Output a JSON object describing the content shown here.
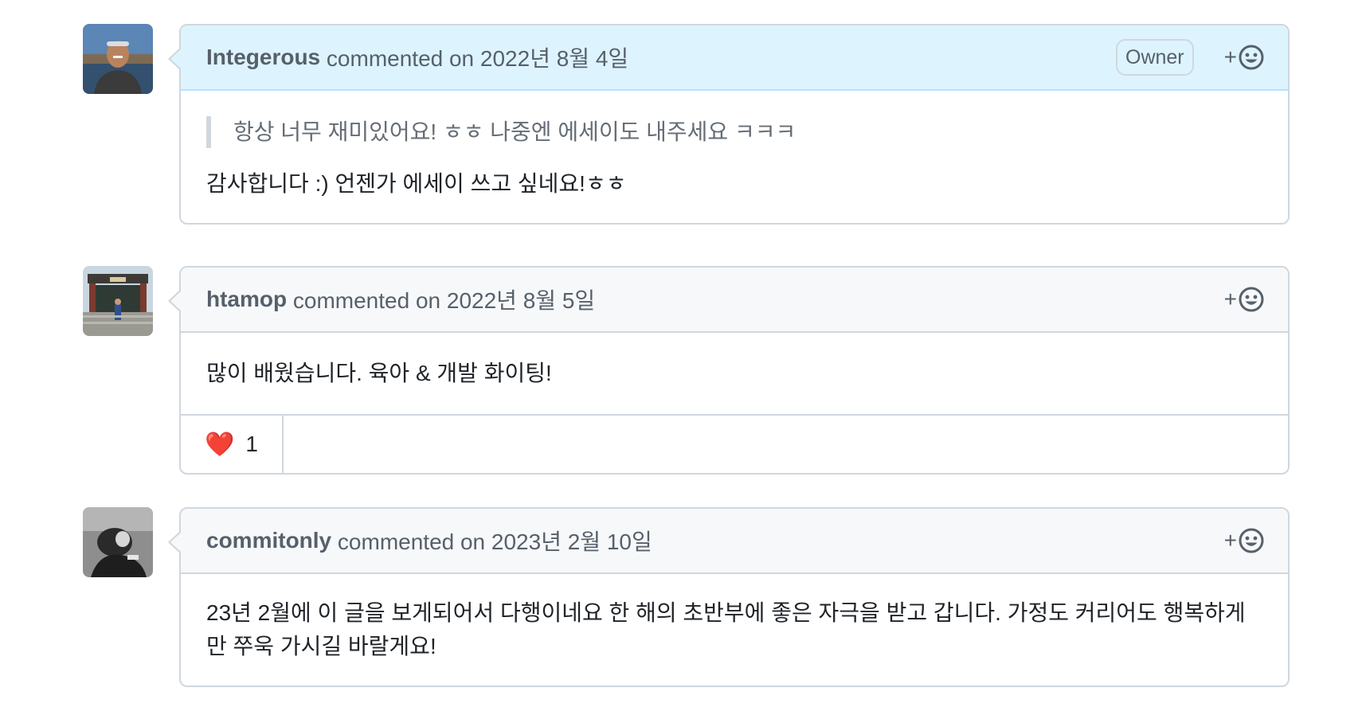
{
  "comments": [
    {
      "author": "Integerous",
      "meta": " commented on 2022년 8월 4일",
      "badge": "Owner",
      "quote": "항상 너무 재미있어요! ㅎㅎ 나중엔 에세이도 내주세요 ㅋㅋㅋ",
      "body": "감사합니다 :) 언젠가 에세이 쓰고 싶네요!ㅎㅎ",
      "avatar": "avatar-portrait-sea"
    },
    {
      "author": "htamop",
      "meta": " commented on 2022년 8월 5일",
      "body": "많이 배웠습니다. 육아 & 개발 화이팅!",
      "avatar": "avatar-palace-gate",
      "reactions": [
        {
          "icon": "heart-icon",
          "emoji": "❤️",
          "count": "1"
        }
      ]
    },
    {
      "author": "commitonly",
      "meta": " commented on 2023년 2월 10일",
      "body": "23년 2월에 이 글을 보게되어서 다행이네요 한 해의 초반부에 좋은 자극을 받고 갑니다. 가정도 커리어도 행복하게만 쭈욱 가시길 바랄게요!",
      "avatar": "avatar-bw-photo"
    }
  ],
  "ui": {
    "react_plus": "+",
    "react_icon": "smiley-icon"
  },
  "colors": {
    "owner_header": "#ddf4ff",
    "header": "#f6f8fa",
    "border": "#d0d7de",
    "heart": "#e02d2d"
  }
}
